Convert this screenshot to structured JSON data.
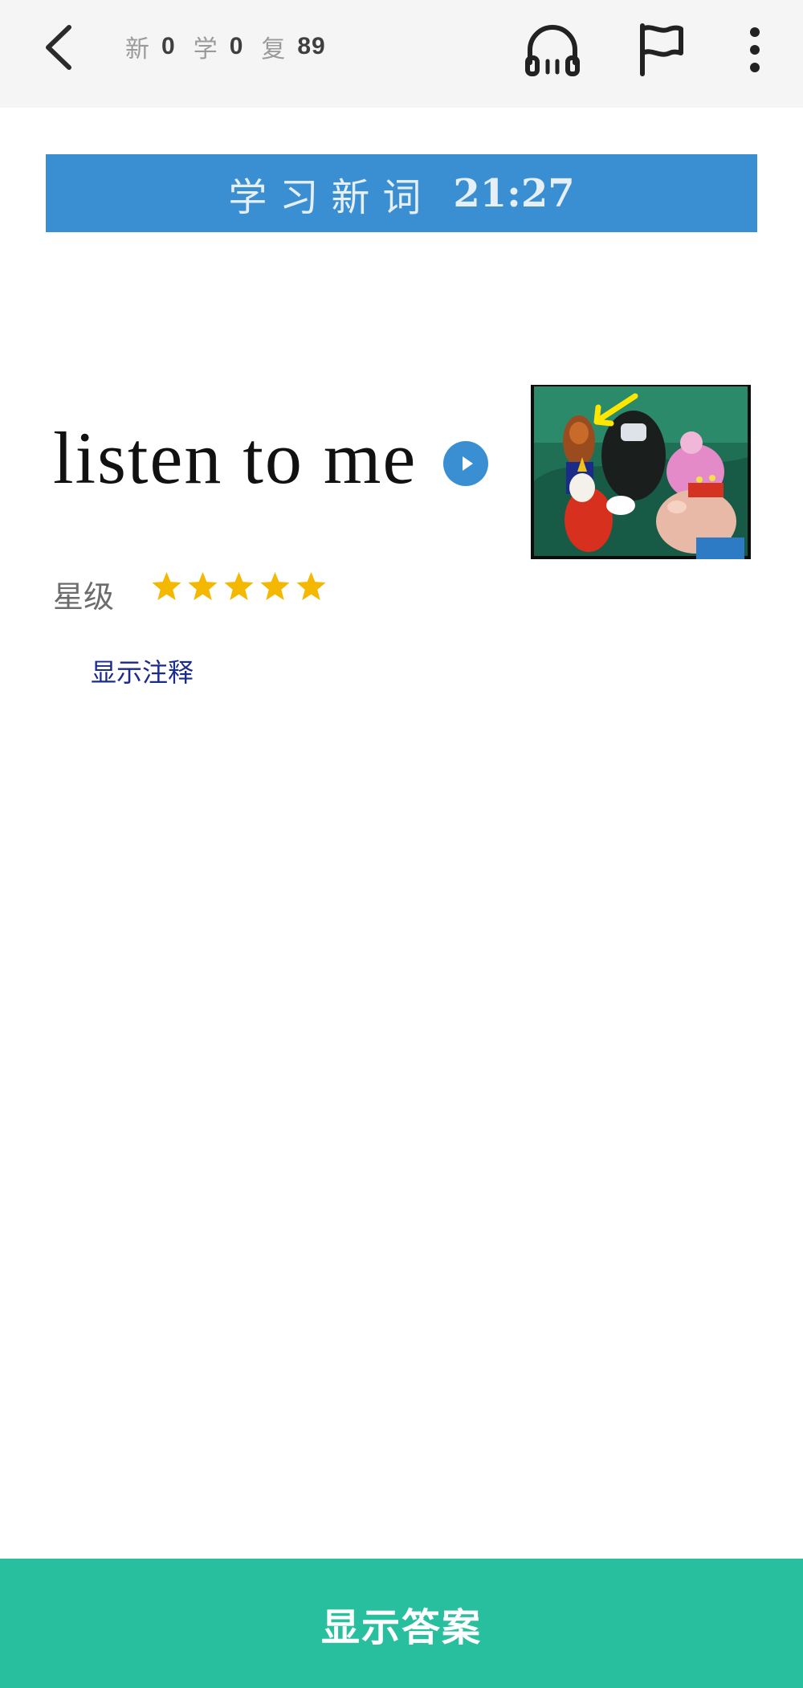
{
  "header": {
    "counters": [
      {
        "label": "新",
        "value": "0"
      },
      {
        "label": "学",
        "value": "0"
      },
      {
        "label": "复",
        "value": "89"
      }
    ],
    "icons": [
      "back-arrow-icon",
      "headphones-icon",
      "flag-icon",
      "more-vertical-icon"
    ]
  },
  "banner": {
    "title": "学习新词",
    "time": "21:27",
    "color": "#3a8fd3"
  },
  "card": {
    "word": "listen to me",
    "play_icon": "play-icon",
    "image_icon": "cartoon-illustration",
    "rating_label": "星级",
    "rating": 5,
    "rating_max": 5,
    "star_color": "#f5b800",
    "show_notes": "显示注释"
  },
  "footer": {
    "answer_label": "显示答案",
    "color": "#27bf9e"
  }
}
